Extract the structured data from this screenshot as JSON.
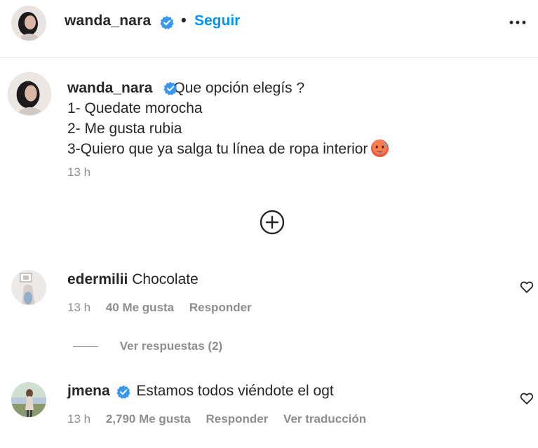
{
  "header": {
    "username": "wanda_nara",
    "separator": "•",
    "follow_label": "Seguir"
  },
  "caption": {
    "username": "wanda_nara",
    "lines": [
      "Que opción elegís ?",
      "1- Quedate morocha",
      "2- Me gusta rubia",
      "3-Quiero que ya salga tu línea de ropa interior"
    ],
    "emoji": "hot-face-emoji",
    "time": "13 h"
  },
  "comments": [
    {
      "username": "edermilii",
      "text": "Chocolate",
      "time": "13 h",
      "likes": "40 Me gusta",
      "reply_label": "Responder",
      "view_replies": "Ver respuestas (2)"
    },
    {
      "username": "jmena",
      "verified": true,
      "text": "Estamos todos viéndote el ogt",
      "time": "13 h",
      "likes": "2,790 Me gusta",
      "reply_label": "Responder",
      "translate_label": "Ver traducción"
    }
  ],
  "icons": {
    "verified": "verified-badge-icon",
    "more": "more-options-icon",
    "expand": "plus-circle-icon",
    "like": "heart-icon"
  },
  "colors": {
    "link": "#0095f6",
    "verified": "#3897f0",
    "text": "#262626",
    "secondary": "#8e8e8e"
  }
}
